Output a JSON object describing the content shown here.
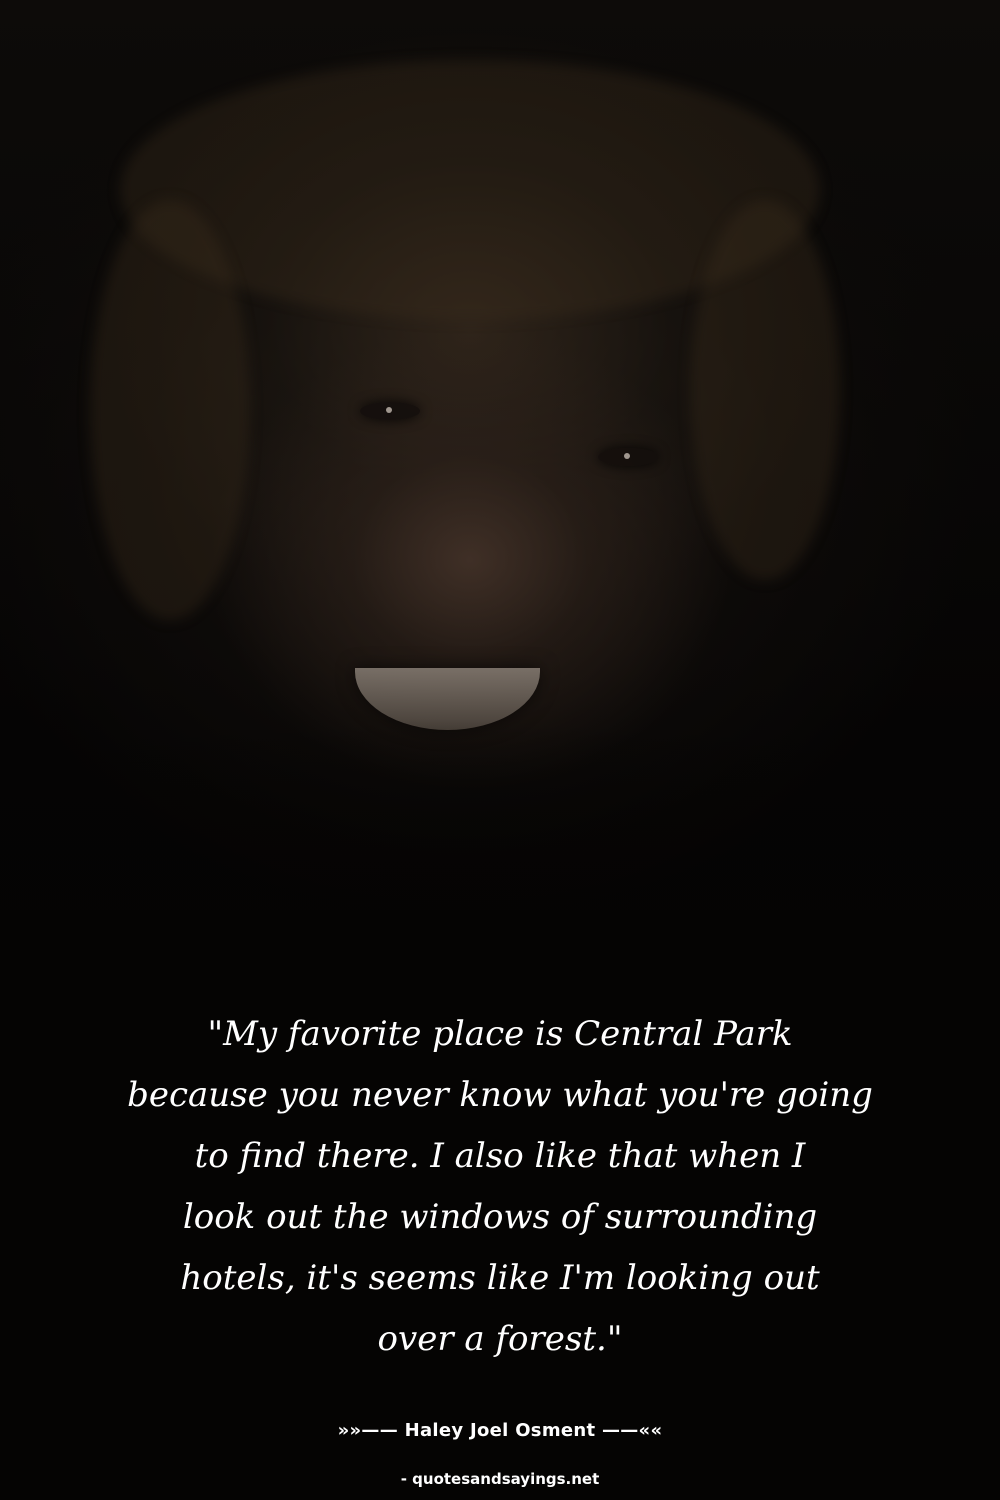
{
  "quote": {
    "text": "\"My favorite place is Central Park\nbecause you never know what you're going\nto find there. I also like that when I\nlook out the windows of surrounding\nhotels, it's seems like I'm looking out\nover a forest.\""
  },
  "author": {
    "line": "»»—— Haley Joel Osment ——««"
  },
  "source": {
    "text": "- quotesandsayings.net"
  },
  "colors": {
    "background": "#050403",
    "text": "#ffffff"
  }
}
